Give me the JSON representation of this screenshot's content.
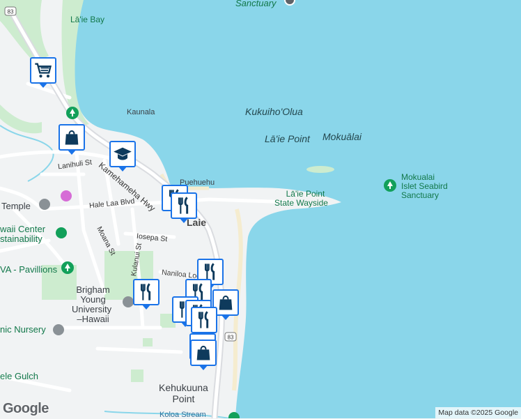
{
  "labels": {
    "sanctuary_top": "Sanctuary",
    "laie_bay": "Lā'ie Bay",
    "kaunala": "Kaunala",
    "kukuiho_olua": "Kukuiho'Olua",
    "laie_point": "Lā'ie Point",
    "mokualai": "Mokuālai",
    "mokualai_sanctuary_1": "Mokualai",
    "mokualai_sanctuary_2": "Islet Seabird",
    "mokualai_sanctuary_3": "Sanctuary",
    "wayside_1": "Lā'ie Point",
    "wayside_2": "State Wayside",
    "puehuehu": "Puehuehu",
    "laie_town": "Laie",
    "temple": "Temple",
    "hawaii_center_1": "waii Center",
    "hawaii_center_2": "stainability",
    "pavillions": "VA - Pavillions",
    "byu_1": "Brigham",
    "byu_2": "Young",
    "byu_3": "University",
    "byu_4": "–Hawaii",
    "nursery": "nic Nursery",
    "gulch": "ele Gulch",
    "kehukuuna_1": "Kehukuuna",
    "kehukuuna_2": "Point",
    "koloa_stream": "Koloa Stream"
  },
  "streets": {
    "lanihuli": "Lanihuli St",
    "kamehameha": "Kamehameha Hwy",
    "hale_laa": "Hale Laa Blvd",
    "iosepa": "Iosepa St",
    "moana": "Moana St",
    "kulanui": "Kulanui St",
    "naniloa": "Naniloa Loop"
  },
  "route_shields": [
    "83",
    "83"
  ],
  "attribution": "Map data ©2025 Google",
  "logo": "Google",
  "colors": {
    "water": "#8ad6ea",
    "land": "#f1f3f4",
    "park": "#cdeccf",
    "road": "#ffffff",
    "highway": "#dadce0",
    "marker_border": "#1a73e8",
    "marker_icon": "#0e3a5c"
  },
  "markers": [
    {
      "type": "grocery-store",
      "icon": "shopping-cart-icon"
    },
    {
      "type": "shop",
      "icon": "shopping-bag-icon"
    },
    {
      "type": "school",
      "icon": "graduation-cap-icon"
    },
    {
      "type": "restaurant",
      "icon": "fork-knife-icon"
    },
    {
      "type": "restaurant",
      "icon": "fork-knife-icon"
    },
    {
      "type": "restaurant",
      "icon": "fork-knife-icon"
    },
    {
      "type": "restaurant",
      "icon": "fork-knife-icon"
    },
    {
      "type": "shop",
      "icon": "shopping-bag-icon"
    },
    {
      "type": "restaurant",
      "icon": "fork-knife-icon"
    },
    {
      "type": "shop",
      "icon": "shopping-bag-icon"
    }
  ]
}
